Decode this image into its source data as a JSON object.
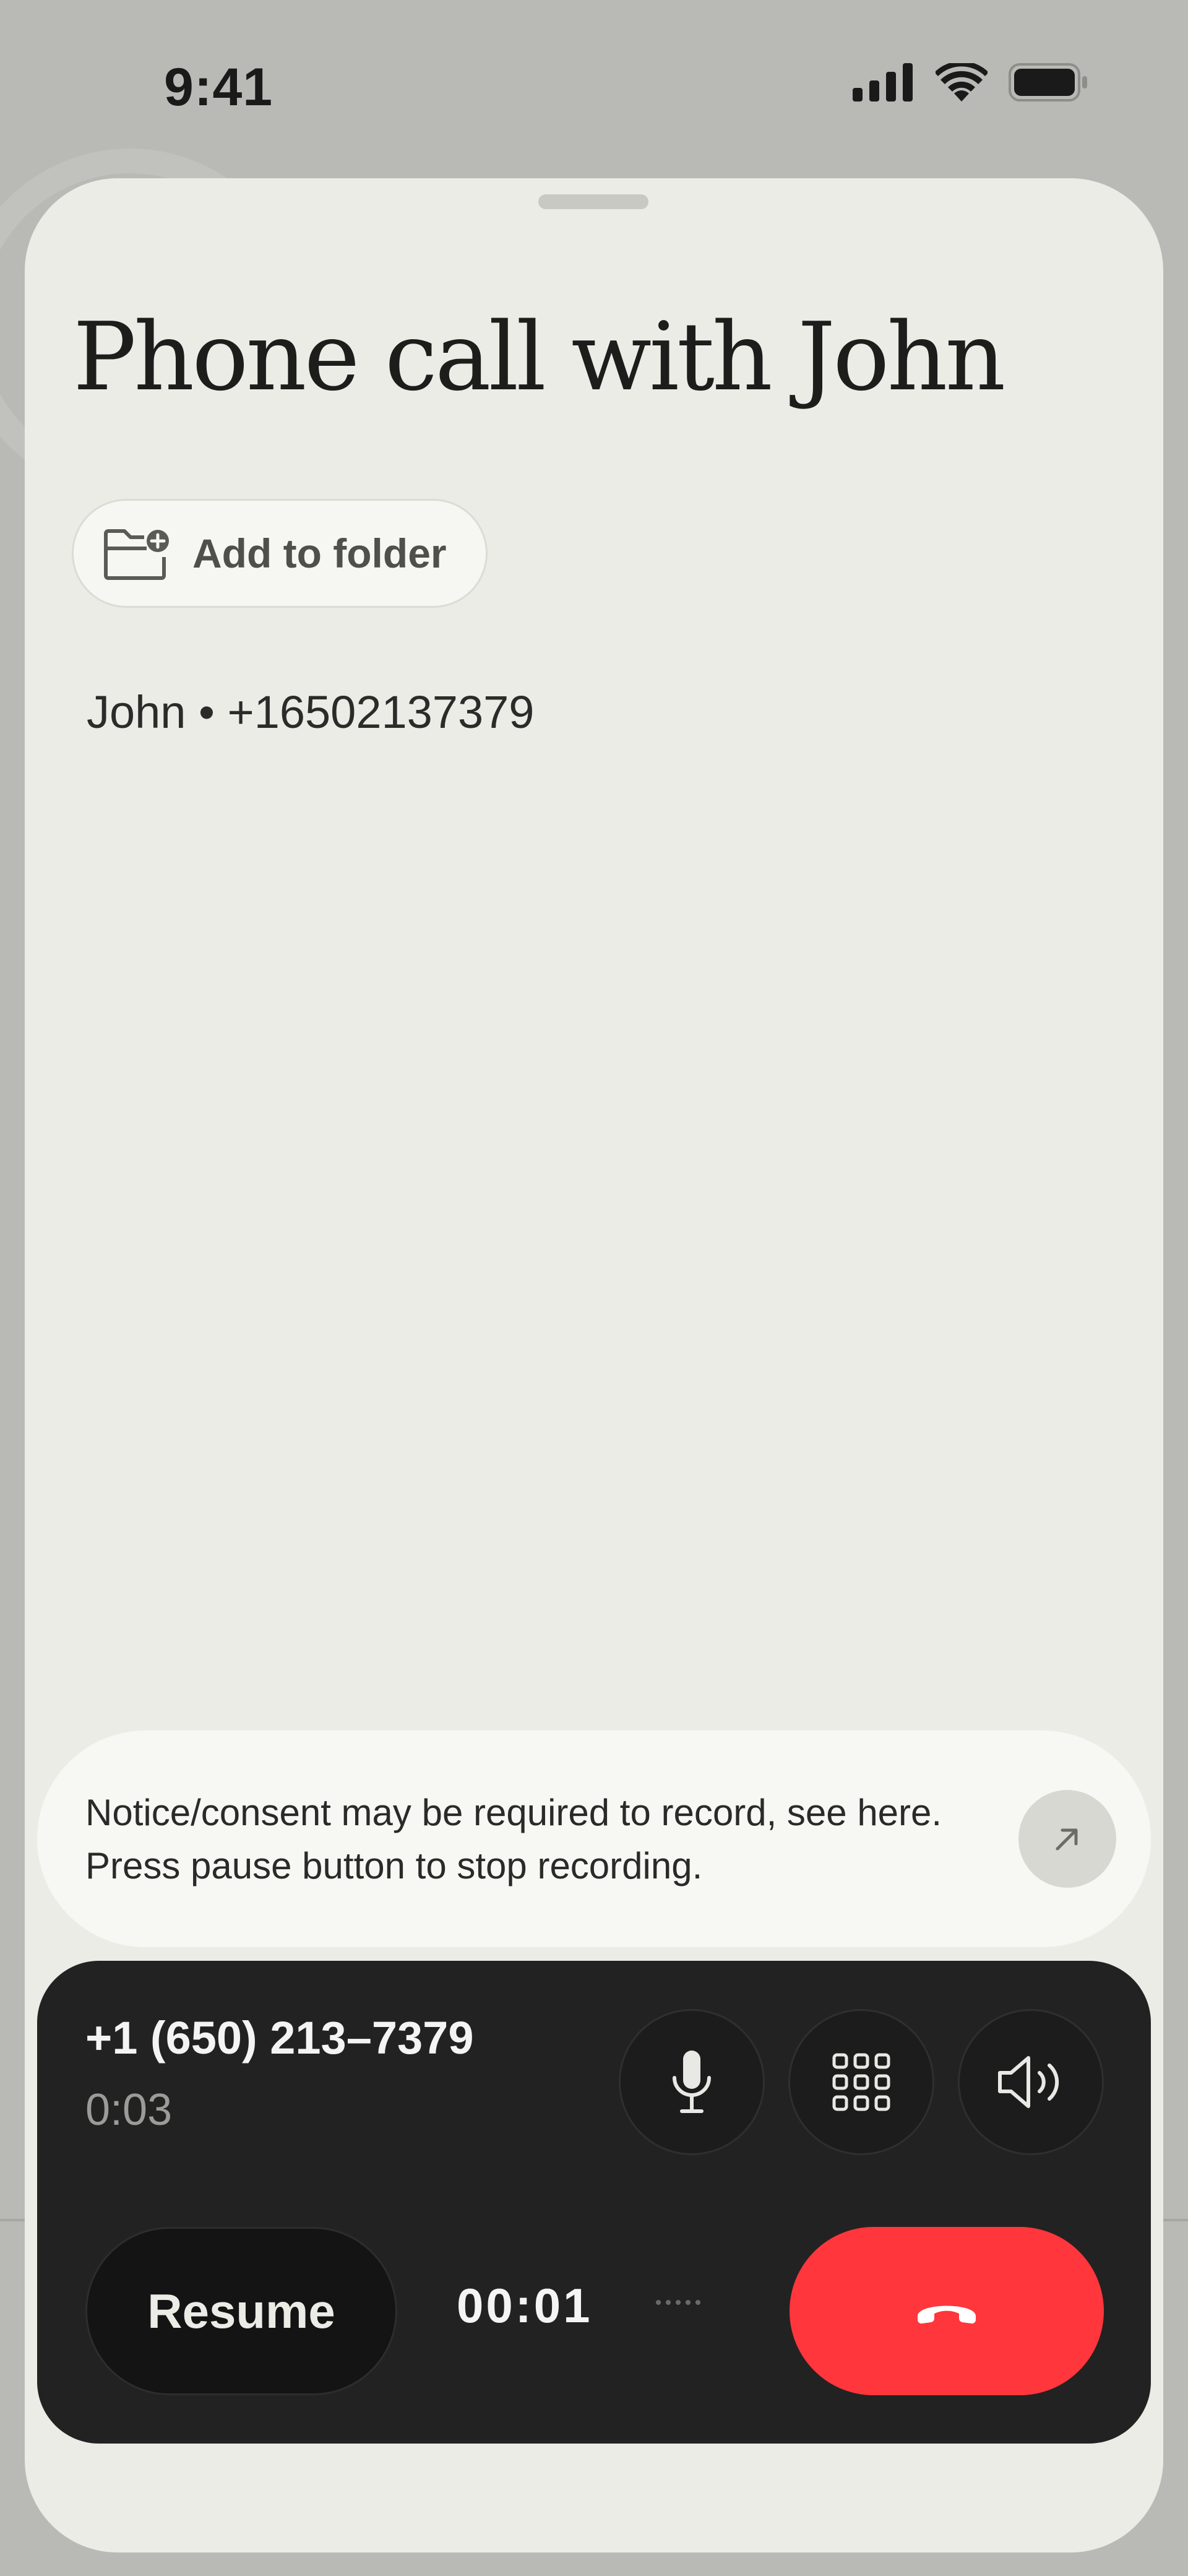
{
  "status_bar": {
    "time": "9:41",
    "icons": [
      "signal-icon",
      "wifi-icon",
      "battery-icon"
    ]
  },
  "page": {
    "title": "Phone call with John",
    "folder_button": {
      "label": "Add to folder",
      "icon": "folder-plus-icon"
    },
    "contact_line": "John • +16502137379"
  },
  "notice": {
    "text": "Notice/consent may be required to record, see here. Press pause button to stop recording.",
    "arrow_icon": "arrow-up-right-icon"
  },
  "call": {
    "number": "+1 (650) 213–7379",
    "duration": "0:03",
    "controls": [
      "microphone-icon",
      "keypad-icon",
      "speaker-icon"
    ],
    "resume_label": "Resume",
    "recording_timer": "00:01",
    "hangup_icon": "phone-hangup-icon"
  },
  "colors": {
    "hangup": "#ff363b",
    "panel": "#222222",
    "sheet": "#ecece7"
  }
}
